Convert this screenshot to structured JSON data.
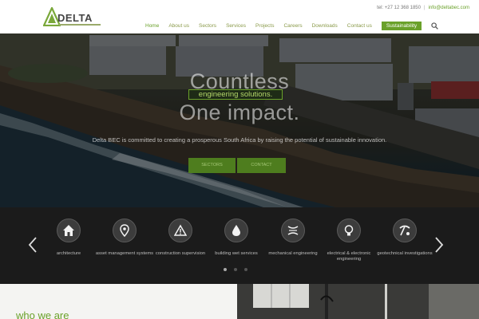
{
  "header": {
    "logo_text": "DELTA",
    "tel": "tel: +27 12 368 1850",
    "email": "info@deltabec.com",
    "nav": [
      {
        "label": "Home"
      },
      {
        "label": "About us"
      },
      {
        "label": "Sectors"
      },
      {
        "label": "Services"
      },
      {
        "label": "Projects"
      },
      {
        "label": "Careers"
      },
      {
        "label": "Downloads"
      },
      {
        "label": "Contact us"
      }
    ],
    "nav_button": "Sustainability"
  },
  "hero": {
    "title_1": "Countless",
    "badge": "engineering solutions.",
    "title_2": "One impact.",
    "text": "Delta BEC is committed to creating a prosperous South Africa by raising the potential of sustainable innovation.",
    "button_1": "SECTORS",
    "button_2": "CONTACT"
  },
  "services": {
    "items": [
      {
        "label": "architecture",
        "icon": "house-icon"
      },
      {
        "label": "asset management systems",
        "icon": "map-pin-icon"
      },
      {
        "label": "construction supervision",
        "icon": "warning-icon"
      },
      {
        "label": "building wet services",
        "icon": "water-drop-icon"
      },
      {
        "label": "mechanical engineering",
        "icon": "road-icon"
      },
      {
        "label": "electrical & electronic engineering",
        "icon": "lightbulb-icon"
      },
      {
        "label": "geotechnical investigations",
        "icon": "pickaxe-icon"
      }
    ],
    "active_slide": 1,
    "slide_count": 3
  },
  "bottom": {
    "heading": "who we are"
  },
  "colors": {
    "accent": "#6aa12a",
    "nav_text": "#8a9a4a",
    "services_bg": "#1b1b1b"
  }
}
